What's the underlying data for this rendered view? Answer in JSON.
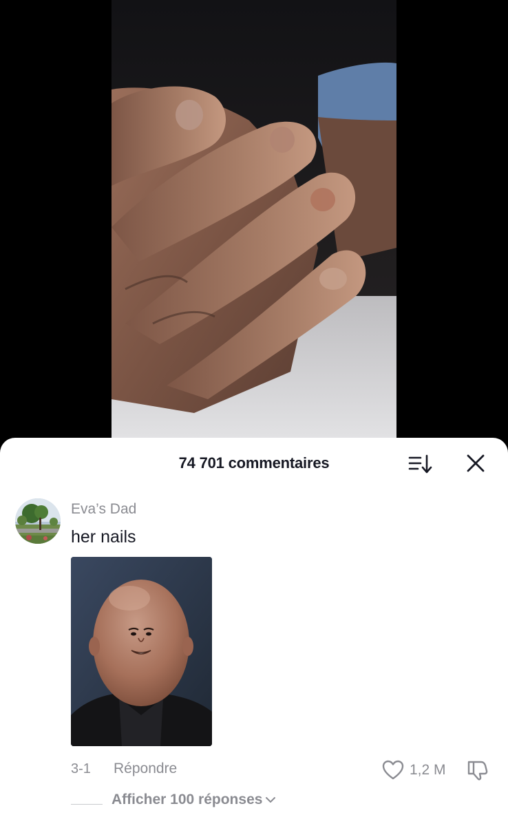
{
  "sheet": {
    "title": "74 701 commentaires",
    "sort_icon": "sort-icon",
    "close_icon": "close-icon"
  },
  "comment": {
    "username": "Eva’s Dad",
    "text": "her nails",
    "date": "3-1",
    "reply_label": "Répondre",
    "like_count": "1,2 M",
    "view_replies_label": "Afficher 100 réponses",
    "icons": [
      "heart-icon",
      "dislike-icon",
      "chevron-down-icon"
    ]
  },
  "colors": {
    "sheet_background": "#ffffff",
    "primary_text": "#161823",
    "secondary_text": "#8a8b91",
    "video_background": "#000000"
  }
}
